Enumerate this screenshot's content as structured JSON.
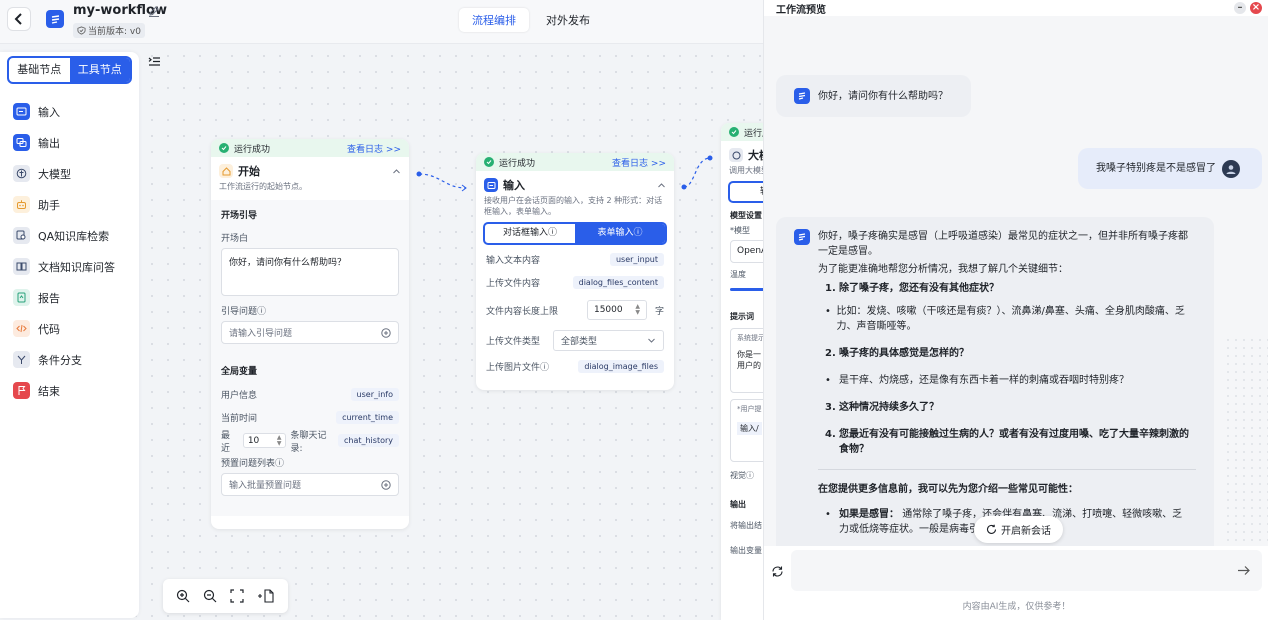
{
  "header": {
    "workflow_name": "my-workflow",
    "version": "当前版本: v0",
    "tabs": [
      {
        "label": "流程编排",
        "active": true
      },
      {
        "label": "对外发布",
        "active": false
      }
    ]
  },
  "left_panel": {
    "segments": [
      {
        "label": "基础节点",
        "active": false
      },
      {
        "label": "工具节点",
        "active": true
      }
    ],
    "nodes": [
      {
        "label": "输入",
        "icon": "input-icon",
        "color": "#2a5ee9"
      },
      {
        "label": "输出",
        "icon": "output-icon",
        "color": "#2a5ee9"
      },
      {
        "label": "大模型",
        "icon": "llm-icon",
        "color": "#3b4a6b"
      },
      {
        "label": "助手",
        "icon": "assistant-icon",
        "color": "#e59a2f"
      },
      {
        "label": "QA知识库检索",
        "icon": "qa-search-icon",
        "color": "#3b4a6b"
      },
      {
        "label": "文档知识库问答",
        "icon": "doc-qa-icon",
        "color": "#3b4a6b"
      },
      {
        "label": "报告",
        "icon": "report-icon",
        "color": "#27a27a"
      },
      {
        "label": "代码",
        "icon": "code-icon",
        "color": "#e8793a"
      },
      {
        "label": "条件分支",
        "icon": "branch-icon",
        "color": "#3b4a6b"
      },
      {
        "label": "结束",
        "icon": "end-icon",
        "color": "#e5484d"
      }
    ]
  },
  "start_node": {
    "status": "运行成功",
    "view_log": "查看日志 >>",
    "title": "开始",
    "desc": "工作流运行的起始节点。",
    "guide_title": "开场引导",
    "opening_label": "开场白",
    "opening_value": "你好，请问你有什么帮助吗？",
    "guide_q_label": "引导问题ⓘ",
    "guide_q_placeholder": "请输入引导问题",
    "global_title": "全局变量",
    "vars": [
      {
        "label": "用户信息",
        "value": "user_info"
      },
      {
        "label": "当前时间",
        "value": "current_time"
      }
    ],
    "recent_prefix": "最近",
    "recent_count": "10",
    "recent_suffix": "条聊天记录:",
    "recent_var": "chat_history",
    "preset_label": "预置问题列表ⓘ",
    "preset_placeholder": "输入批量预置问题"
  },
  "input_node": {
    "status": "运行成功",
    "view_log": "查看日志 >>",
    "title": "输入",
    "desc": "接收用户在会话页面的输入，支持 2 种形式：对话框输入，表单输入。",
    "modes": [
      {
        "label": "对话框输入ⓘ",
        "active": false
      },
      {
        "label": "表单输入ⓘ",
        "active": true
      }
    ],
    "rows": [
      {
        "label": "输入文本内容",
        "value": "user_input"
      },
      {
        "label": "上传文件内容",
        "value": "dialog_files_content"
      }
    ],
    "len_label": "文件内容长度上限",
    "len_value": "15000",
    "len_unit": "字",
    "type_label": "上传文件类型",
    "type_value": "全部类型",
    "img_label": "上传图片文件ⓘ",
    "img_value": "dialog_image_files"
  },
  "llm_node": {
    "status": "运行成",
    "title": "大模",
    "desc": "调用大模型",
    "btn": "输",
    "setting": "模型设置",
    "model_label": "*模型",
    "model_value": "OpenA",
    "temp_label": "温度",
    "prompt_title": "提示词",
    "sys_label": "系统提示",
    "sys_value": "你是一用户的",
    "user_label": "*用户提",
    "user_value": "输入/",
    "vision_label": "视觉ⓘ",
    "output_title": "输出",
    "out1": "将输出结",
    "out2": "输出变量"
  },
  "chat": {
    "title": "工作流预览",
    "greeting": "你好，请问你有什么帮助吗？",
    "user_msg": "我嗓子特别疼是不是感冒了",
    "answer_intro": "你好，嗓子疼确实是感冒（上呼吸道感染）最常见的症状之一，但并非所有嗓子疼都一定是感冒。",
    "answer_lead": "为了能更准确地帮您分析情况，我想了解几个关键细节：",
    "questions": [
      {
        "num": "1.",
        "q": "除了嗓子疼，您还有没有其他症状？",
        "detail": "比如：发烧、咳嗽（干咳还是有痰？）、流鼻涕/鼻塞、头痛、全身肌肉酸痛、乏力、声音嘶哑等。"
      },
      {
        "num": "2.",
        "q": "嗓子疼的具体感觉是怎样的？",
        "detail": "是干痒、灼烧感，还是像有东西卡着一样的刺痛或吞咽时特别疼？"
      },
      {
        "num": "3.",
        "q": "这种情况持续多久了？",
        "detail": ""
      },
      {
        "num": "4.",
        "q": "您最近有没有可能接触过生病的人？或者有没有过度用嗓、吃了大量辛辣刺激的食物？",
        "detail": ""
      }
    ],
    "before_info": "在您提供更多信息前，我可以先为您介绍一些常见可能性：",
    "cold_bold": "如果是感冒：",
    "cold_text": "通常除了嗓子疼，还会伴有鼻塞、流涕、打喷嚏、轻微咳嗽、乏力或低烧等症状。一般是病毒引起的。",
    "new_chat": "开启新会话",
    "input_placeholder": "",
    "footer": "内容由AI生成，仅供参考！"
  }
}
